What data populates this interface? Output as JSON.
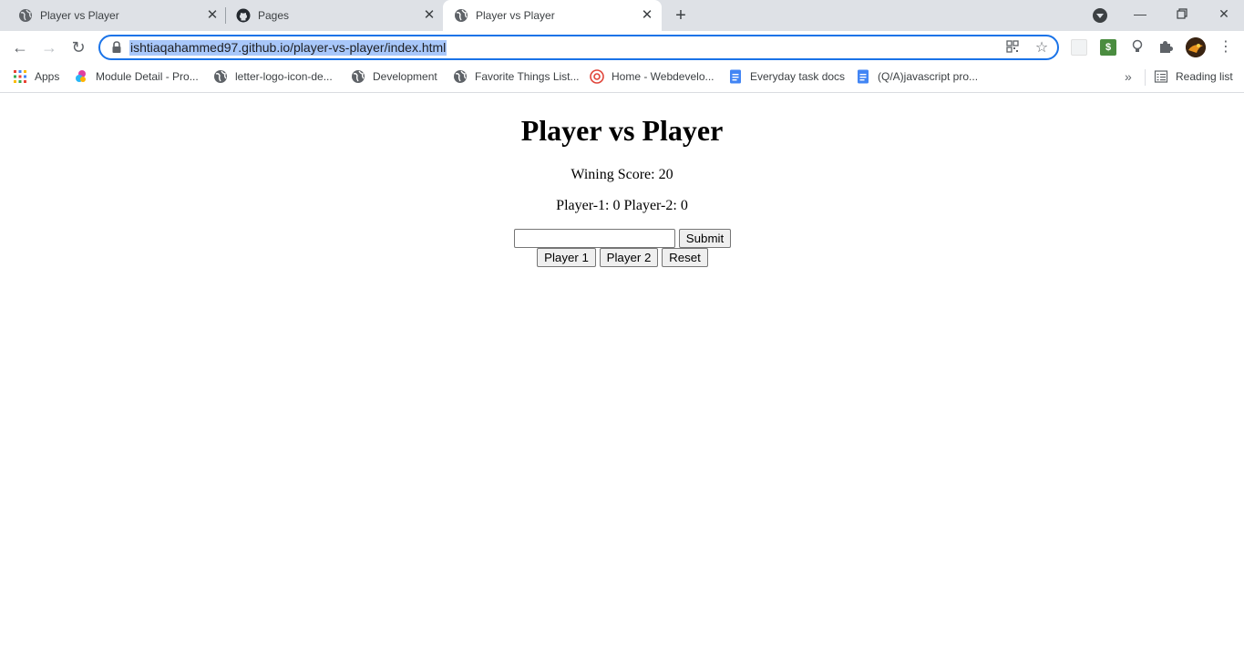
{
  "browser": {
    "tabs": [
      {
        "title": "Player vs Player",
        "icon": "globe-icon",
        "active": false
      },
      {
        "title": "Pages",
        "icon": "github-icon",
        "active": false
      },
      {
        "title": "Player vs Player",
        "icon": "globe-icon",
        "active": true
      }
    ],
    "new_tab_label": "+",
    "address": {
      "url": "ishtiaqahammed97.github.io/player-vs-player/index.html"
    },
    "bookmarks": [
      {
        "label": "Apps",
        "icon": "apps-grid-icon"
      },
      {
        "label": "Module Detail - Pro...",
        "icon": "colorful-logo-icon"
      },
      {
        "label": "letter-logo-icon-de...",
        "icon": "globe-icon"
      },
      {
        "label": "Development",
        "icon": "globe-icon"
      },
      {
        "label": "Favorite Things List...",
        "icon": "globe-icon"
      },
      {
        "label": "Home - Webdevelo...",
        "icon": "target-icon"
      },
      {
        "label": "Everyday task docs",
        "icon": "docs-icon"
      },
      {
        "label": "(Q/A)javascript pro...",
        "icon": "docs-icon"
      }
    ],
    "more_bookmarks": "»",
    "reading_list": "Reading list",
    "colors": {
      "tab_strip": "#dee1e6",
      "focus_ring": "#1a73e8",
      "url_selection": "#a8c7fa"
    }
  },
  "page": {
    "title": "Player vs Player",
    "winning_score_text": "Wining Score: 20",
    "scores_text": "Player-1: 0 Player-2: 0",
    "input_value": "",
    "submit_label": "Submit",
    "player1_label": "Player 1",
    "player2_label": "Player 2",
    "reset_label": "Reset"
  }
}
